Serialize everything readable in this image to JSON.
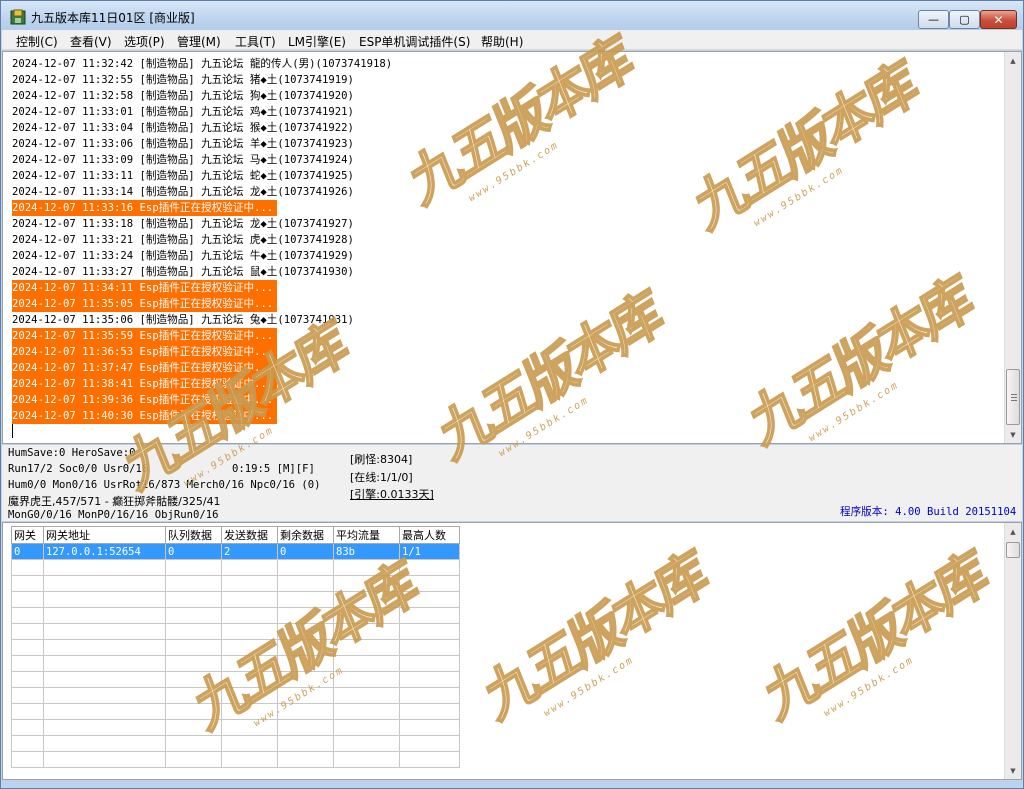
{
  "window": {
    "title": "九五版本库11日01区 [商业版]",
    "min_symbol": "—",
    "max_symbol": "▢",
    "close_symbol": "✕"
  },
  "menu": [
    "控制(C)",
    "查看(V)",
    "选项(P)",
    "管理(M)",
    "工具(T)",
    "LM引擎(E)",
    "ESP单机调试插件(S)",
    "帮助(H)"
  ],
  "log": [
    {
      "text": "2024-12-07 11:32:42 [制造物品] 九五论坛 龍的传人(男)(1073741918)",
      "highlight": false
    },
    {
      "text": "2024-12-07 11:32:55 [制造物品] 九五论坛 猪◆土(1073741919)",
      "highlight": false
    },
    {
      "text": "2024-12-07 11:32:58 [制造物品] 九五论坛 狗◆土(1073741920)",
      "highlight": false
    },
    {
      "text": "2024-12-07 11:33:01 [制造物品] 九五论坛 鸡◆土(1073741921)",
      "highlight": false
    },
    {
      "text": "2024-12-07 11:33:04 [制造物品] 九五论坛 猴◆土(1073741922)",
      "highlight": false
    },
    {
      "text": "2024-12-07 11:33:06 [制造物品] 九五论坛 羊◆土(1073741923)",
      "highlight": false
    },
    {
      "text": "2024-12-07 11:33:09 [制造物品] 九五论坛 马◆土(1073741924)",
      "highlight": false
    },
    {
      "text": "2024-12-07 11:33:11 [制造物品] 九五论坛 蛇◆土(1073741925)",
      "highlight": false
    },
    {
      "text": "2024-12-07 11:33:14 [制造物品] 九五论坛 龙◆土(1073741926)",
      "highlight": false
    },
    {
      "text": "2024-12-07 11:33:16 Esp插件正在授权验证中...",
      "highlight": true
    },
    {
      "text": "2024-12-07 11:33:18 [制造物品] 九五论坛 龙◆土(1073741927)",
      "highlight": false
    },
    {
      "text": "2024-12-07 11:33:21 [制造物品] 九五论坛 虎◆土(1073741928)",
      "highlight": false
    },
    {
      "text": "2024-12-07 11:33:24 [制造物品] 九五论坛 牛◆土(1073741929)",
      "highlight": false
    },
    {
      "text": "2024-12-07 11:33:27 [制造物品] 九五论坛 鼠◆土(1073741930)",
      "highlight": false
    },
    {
      "text": "2024-12-07 11:34:11 Esp插件正在授权验证中...",
      "highlight": true
    },
    {
      "text": "2024-12-07 11:35:05 Esp插件正在授权验证中...",
      "highlight": true
    },
    {
      "text": "2024-12-07 11:35:06 [制造物品] 九五论坛 兔◆土(1073741931)",
      "highlight": false
    },
    {
      "text": "2024-12-07 11:35:59 Esp插件正在授权验证中...",
      "highlight": true
    },
    {
      "text": "2024-12-07 11:36:53 Esp插件正在授权验证中...",
      "highlight": true
    },
    {
      "text": "2024-12-07 11:37:47 Esp插件正在授权验证中...",
      "highlight": true
    },
    {
      "text": "2024-12-07 11:38:41 Esp插件正在授权验证中...",
      "highlight": true
    },
    {
      "text": "2024-12-07 11:39:36 Esp插件正在授权验证中...",
      "highlight": true
    },
    {
      "text": "2024-12-07 11:40:30 Esp插件正在授权验证中...",
      "highlight": true
    }
  ],
  "status": {
    "hum_save": "HumSave:0 HeroSave:0",
    "run": "Run17/2 Soc0/0 Usr0/16",
    "time": "0:19:5 [M][F]",
    "hum": "Hum0/0 Mon0/16 UsrRot16/873 Merch0/16 Npc0/16 (0)",
    "boss": "魔界虎王,457/571 - 癫狂掷斧骷髅/325/41",
    "mon": "MonG0/0/16 MonP0/16/16 ObjRun0/16",
    "refresh": "[刷怪:8304]",
    "online": "[在线:1/1/0]",
    "engine": "[引擎:0.0133天]",
    "version": "程序版本: 4.00 Build 20151104"
  },
  "table": {
    "headers": [
      "网关",
      "网关地址",
      "队列数据",
      "发送数据",
      "剩余数据",
      "平均流量",
      "最高人数"
    ],
    "rows": [
      [
        "0",
        "127.0.0.1:52654",
        "0",
        "2",
        "0",
        "83b",
        "1/1"
      ]
    ],
    "empty_rows": 13
  },
  "watermark": {
    "big": "九五版本库",
    "small": "www.95bbk.com"
  },
  "colors": {
    "highlight": "#ff6f00",
    "selection": "#3399ff",
    "version_text": "#0000c8"
  }
}
